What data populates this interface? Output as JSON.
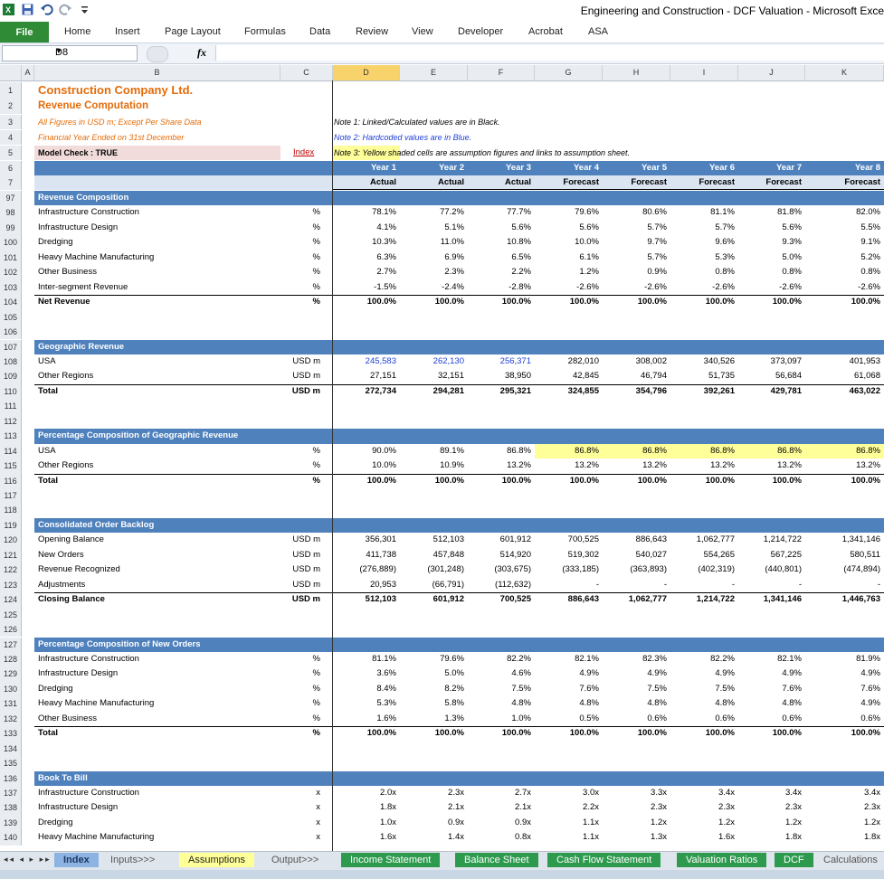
{
  "window": {
    "title": "Engineering and Construction - DCF Valuation  -  Microsoft Exce"
  },
  "ribbon": {
    "file": "File",
    "tabs": [
      "Home",
      "Insert",
      "Page Layout",
      "Formulas",
      "Data",
      "Review",
      "View",
      "Developer",
      "Acrobat",
      "ASA"
    ]
  },
  "formula_bar": {
    "name_box": "D8",
    "fx": "fx",
    "value": ""
  },
  "columns": [
    "A",
    "B",
    "C",
    "D",
    "E",
    "F",
    "G",
    "H",
    "I",
    "J",
    "K"
  ],
  "header": {
    "company": "Construction Company Ltd.",
    "subtitle": "Revenue Computation",
    "line3": "All Figures in USD m; Except Per Share Data",
    "line4": "Financial Year Ended on 31st December",
    "model_check": "Model Check : TRUE",
    "index_link": "Index",
    "note1": "Note 1: Linked/Calculated values are in Black.",
    "note2": "Note 2: Hardcoded values are in Blue.",
    "note3": "Note 3: Yellow shaded cells are assumption figures and links to assumption sheet.",
    "years": [
      "Year 1",
      "Year 2",
      "Year 3",
      "Year 4",
      "Year 5",
      "Year 6",
      "Year 7",
      "Year 8"
    ],
    "types": [
      "Actual",
      "Actual",
      "Actual",
      "Forecast",
      "Forecast",
      "Forecast",
      "Forecast",
      "Forecast"
    ]
  },
  "rows": [
    {
      "n": "97",
      "label": "Revenue Composition",
      "kind": "band"
    },
    {
      "n": "98",
      "label": "Infrastructure Construction",
      "unit": "%",
      "vals": [
        "78.1%",
        "77.2%",
        "77.7%",
        "79.6%",
        "80.6%",
        "81.1%",
        "81.8%",
        "82.0%"
      ]
    },
    {
      "n": "99",
      "label": "Infrastructure Design",
      "unit": "%",
      "vals": [
        "4.1%",
        "5.1%",
        "5.6%",
        "5.6%",
        "5.7%",
        "5.7%",
        "5.6%",
        "5.5%"
      ]
    },
    {
      "n": "100",
      "label": "Dredging",
      "unit": "%",
      "vals": [
        "10.3%",
        "11.0%",
        "10.8%",
        "10.0%",
        "9.7%",
        "9.6%",
        "9.3%",
        "9.1%"
      ]
    },
    {
      "n": "101",
      "label": "Heavy Machine Manufacturing",
      "unit": "%",
      "vals": [
        "6.3%",
        "6.9%",
        "6.5%",
        "6.1%",
        "5.7%",
        "5.3%",
        "5.0%",
        "5.2%"
      ]
    },
    {
      "n": "102",
      "label": "Other Business",
      "unit": "%",
      "vals": [
        "2.7%",
        "2.3%",
        "2.2%",
        "1.2%",
        "0.9%",
        "0.8%",
        "0.8%",
        "0.8%"
      ]
    },
    {
      "n": "103",
      "label": "Inter-segment Revenue",
      "unit": "%",
      "vals": [
        "-1.5%",
        "-2.4%",
        "-2.8%",
        "-2.6%",
        "-2.6%",
        "-2.6%",
        "-2.6%",
        "-2.6%"
      ]
    },
    {
      "n": "104",
      "label": "Net Revenue",
      "unit": "%",
      "kind": "total",
      "vals": [
        "100.0%",
        "100.0%",
        "100.0%",
        "100.0%",
        "100.0%",
        "100.0%",
        "100.0%",
        "100.0%"
      ]
    },
    {
      "n": "105",
      "kind": "blank"
    },
    {
      "n": "106",
      "kind": "blank"
    },
    {
      "n": "107",
      "label": "Geographic Revenue",
      "kind": "band"
    },
    {
      "n": "108",
      "label": "USA",
      "unit": "USD m",
      "vals": [
        "245,583",
        "262,130",
        "256,371",
        "282,010",
        "308,002",
        "340,526",
        "373,097",
        "401,953"
      ],
      "blue": 3
    },
    {
      "n": "109",
      "label": "Other Regions",
      "unit": "USD m",
      "vals": [
        "27,151",
        "32,151",
        "38,950",
        "42,845",
        "46,794",
        "51,735",
        "56,684",
        "61,068"
      ]
    },
    {
      "n": "110",
      "label": "Total",
      "unit": "USD m",
      "kind": "total",
      "vals": [
        "272,734",
        "294,281",
        "295,321",
        "324,855",
        "354,796",
        "392,261",
        "429,781",
        "463,022"
      ]
    },
    {
      "n": "111",
      "kind": "blank"
    },
    {
      "n": "112",
      "kind": "blank"
    },
    {
      "n": "113",
      "label": "Percentage Composition of Geographic Revenue",
      "kind": "band"
    },
    {
      "n": "114",
      "label": "USA",
      "unit": "%",
      "vals": [
        "90.0%",
        "89.1%",
        "86.8%",
        "86.8%",
        "86.8%",
        "86.8%",
        "86.8%",
        "86.8%"
      ],
      "yellow": true
    },
    {
      "n": "115",
      "label": "Other Regions",
      "unit": "%",
      "vals": [
        "10.0%",
        "10.9%",
        "13.2%",
        "13.2%",
        "13.2%",
        "13.2%",
        "13.2%",
        "13.2%"
      ]
    },
    {
      "n": "116",
      "label": "Total",
      "unit": "%",
      "kind": "total",
      "vals": [
        "100.0%",
        "100.0%",
        "100.0%",
        "100.0%",
        "100.0%",
        "100.0%",
        "100.0%",
        "100.0%"
      ]
    },
    {
      "n": "117",
      "kind": "blank"
    },
    {
      "n": "118",
      "kind": "blank"
    },
    {
      "n": "119",
      "label": "Consolidated Order Backlog",
      "kind": "band"
    },
    {
      "n": "120",
      "label": "Opening Balance",
      "unit": "USD m",
      "vals": [
        "356,301",
        "512,103",
        "601,912",
        "700,525",
        "886,643",
        "1,062,777",
        "1,214,722",
        "1,341,146"
      ]
    },
    {
      "n": "121",
      "label": "New Orders",
      "unit": "USD m",
      "vals": [
        "411,738",
        "457,848",
        "514,920",
        "519,302",
        "540,027",
        "554,265",
        "567,225",
        "580,511"
      ]
    },
    {
      "n": "122",
      "label": "Revenue Recognized",
      "unit": "USD m",
      "vals": [
        "(276,889)",
        "(301,248)",
        "(303,675)",
        "(333,185)",
        "(363,893)",
        "(402,319)",
        "(440,801)",
        "(474,894)"
      ]
    },
    {
      "n": "123",
      "label": "Adjustments",
      "unit": "USD m",
      "vals": [
        "20,953",
        "(66,791)",
        "(112,632)",
        "-",
        "-",
        "-",
        "-",
        "-"
      ]
    },
    {
      "n": "124",
      "label": "Closing Balance",
      "unit": "USD m",
      "kind": "total",
      "vals": [
        "512,103",
        "601,912",
        "700,525",
        "886,643",
        "1,062,777",
        "1,214,722",
        "1,341,146",
        "1,446,763"
      ]
    },
    {
      "n": "125",
      "kind": "blank"
    },
    {
      "n": "126",
      "kind": "blank"
    },
    {
      "n": "127",
      "label": "Percentage Composition of New Orders",
      "kind": "band"
    },
    {
      "n": "128",
      "label": "Infrastructure Construction",
      "unit": "%",
      "vals": [
        "81.1%",
        "79.6%",
        "82.2%",
        "82.1%",
        "82.3%",
        "82.2%",
        "82.1%",
        "81.9%"
      ]
    },
    {
      "n": "129",
      "label": "Infrastructure Design",
      "unit": "%",
      "vals": [
        "3.6%",
        "5.0%",
        "4.6%",
        "4.9%",
        "4.9%",
        "4.9%",
        "4.9%",
        "4.9%"
      ]
    },
    {
      "n": "130",
      "label": "Dredging",
      "unit": "%",
      "vals": [
        "8.4%",
        "8.2%",
        "7.5%",
        "7.6%",
        "7.5%",
        "7.5%",
        "7.6%",
        "7.6%"
      ]
    },
    {
      "n": "131",
      "label": "Heavy Machine Manufacturing",
      "unit": "%",
      "vals": [
        "5.3%",
        "5.8%",
        "4.8%",
        "4.8%",
        "4.8%",
        "4.8%",
        "4.8%",
        "4.9%"
      ]
    },
    {
      "n": "132",
      "label": "Other Business",
      "unit": "%",
      "vals": [
        "1.6%",
        "1.3%",
        "1.0%",
        "0.5%",
        "0.6%",
        "0.6%",
        "0.6%",
        "0.6%"
      ]
    },
    {
      "n": "133",
      "label": "Total",
      "unit": "%",
      "kind": "total",
      "vals": [
        "100.0%",
        "100.0%",
        "100.0%",
        "100.0%",
        "100.0%",
        "100.0%",
        "100.0%",
        "100.0%"
      ]
    },
    {
      "n": "134",
      "kind": "blank"
    },
    {
      "n": "135",
      "kind": "blank"
    },
    {
      "n": "136",
      "label": "Book To Bill",
      "kind": "band"
    },
    {
      "n": "137",
      "label": "Infrastructure Construction",
      "unit": "x",
      "vals": [
        "2.0x",
        "2.3x",
        "2.7x",
        "3.0x",
        "3.3x",
        "3.4x",
        "3.4x",
        "3.4x"
      ]
    },
    {
      "n": "138",
      "label": "Infrastructure Design",
      "unit": "x",
      "vals": [
        "1.8x",
        "2.1x",
        "2.1x",
        "2.2x",
        "2.3x",
        "2.3x",
        "2.3x",
        "2.3x"
      ]
    },
    {
      "n": "139",
      "label": "Dredging",
      "unit": "x",
      "vals": [
        "1.0x",
        "0.9x",
        "0.9x",
        "1.1x",
        "1.2x",
        "1.2x",
        "1.2x",
        "1.2x"
      ]
    },
    {
      "n": "140",
      "label": "Heavy Machine Manufacturing",
      "unit": "x",
      "vals": [
        "1.6x",
        "1.4x",
        "0.8x",
        "1.1x",
        "1.3x",
        "1.6x",
        "1.8x",
        "1.8x"
      ]
    }
  ],
  "sheet_tabs": [
    "Index",
    "Inputs>>>",
    "Assumptions",
    "Output>>>",
    "Income Statement",
    "Balance Sheet",
    "Cash Flow Statement",
    "Valuation Ratios",
    "DCF",
    "Calculations"
  ],
  "colors": {
    "band": "#4f81bd",
    "file_tab": "#2f8b35",
    "orange": "#e46c0a",
    "hardcoded": "#1f3fd6",
    "assumption": "#ffff99",
    "green_tab": "#2e9a4e"
  }
}
